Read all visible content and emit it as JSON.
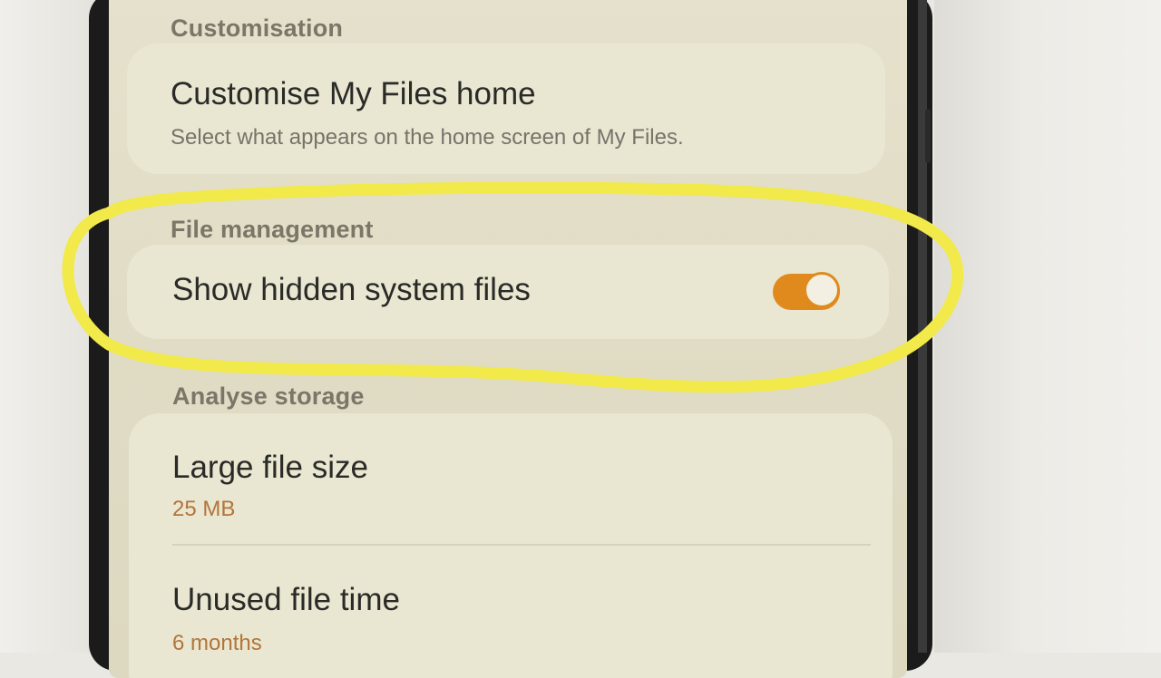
{
  "sections": {
    "customisation": {
      "header": "Customisation",
      "item": {
        "title": "Customise My Files home",
        "subtitle": "Select what appears on the home screen of My Files."
      }
    },
    "file_management": {
      "header": "File management",
      "item": {
        "title": "Show hidden system files",
        "toggle_on": true
      }
    },
    "analyse_storage": {
      "header": "Analyse storage",
      "items": [
        {
          "title": "Large file size",
          "value": "25 MB"
        },
        {
          "title": "Unused file time",
          "value": "6 months"
        }
      ]
    }
  },
  "colors": {
    "accent": "#e08a1e",
    "highlight_marker": "#f2e94a",
    "screen_bg": "#e2decb"
  },
  "annotation": {
    "shape": "hand-drawn ellipse",
    "target": "file_management"
  }
}
